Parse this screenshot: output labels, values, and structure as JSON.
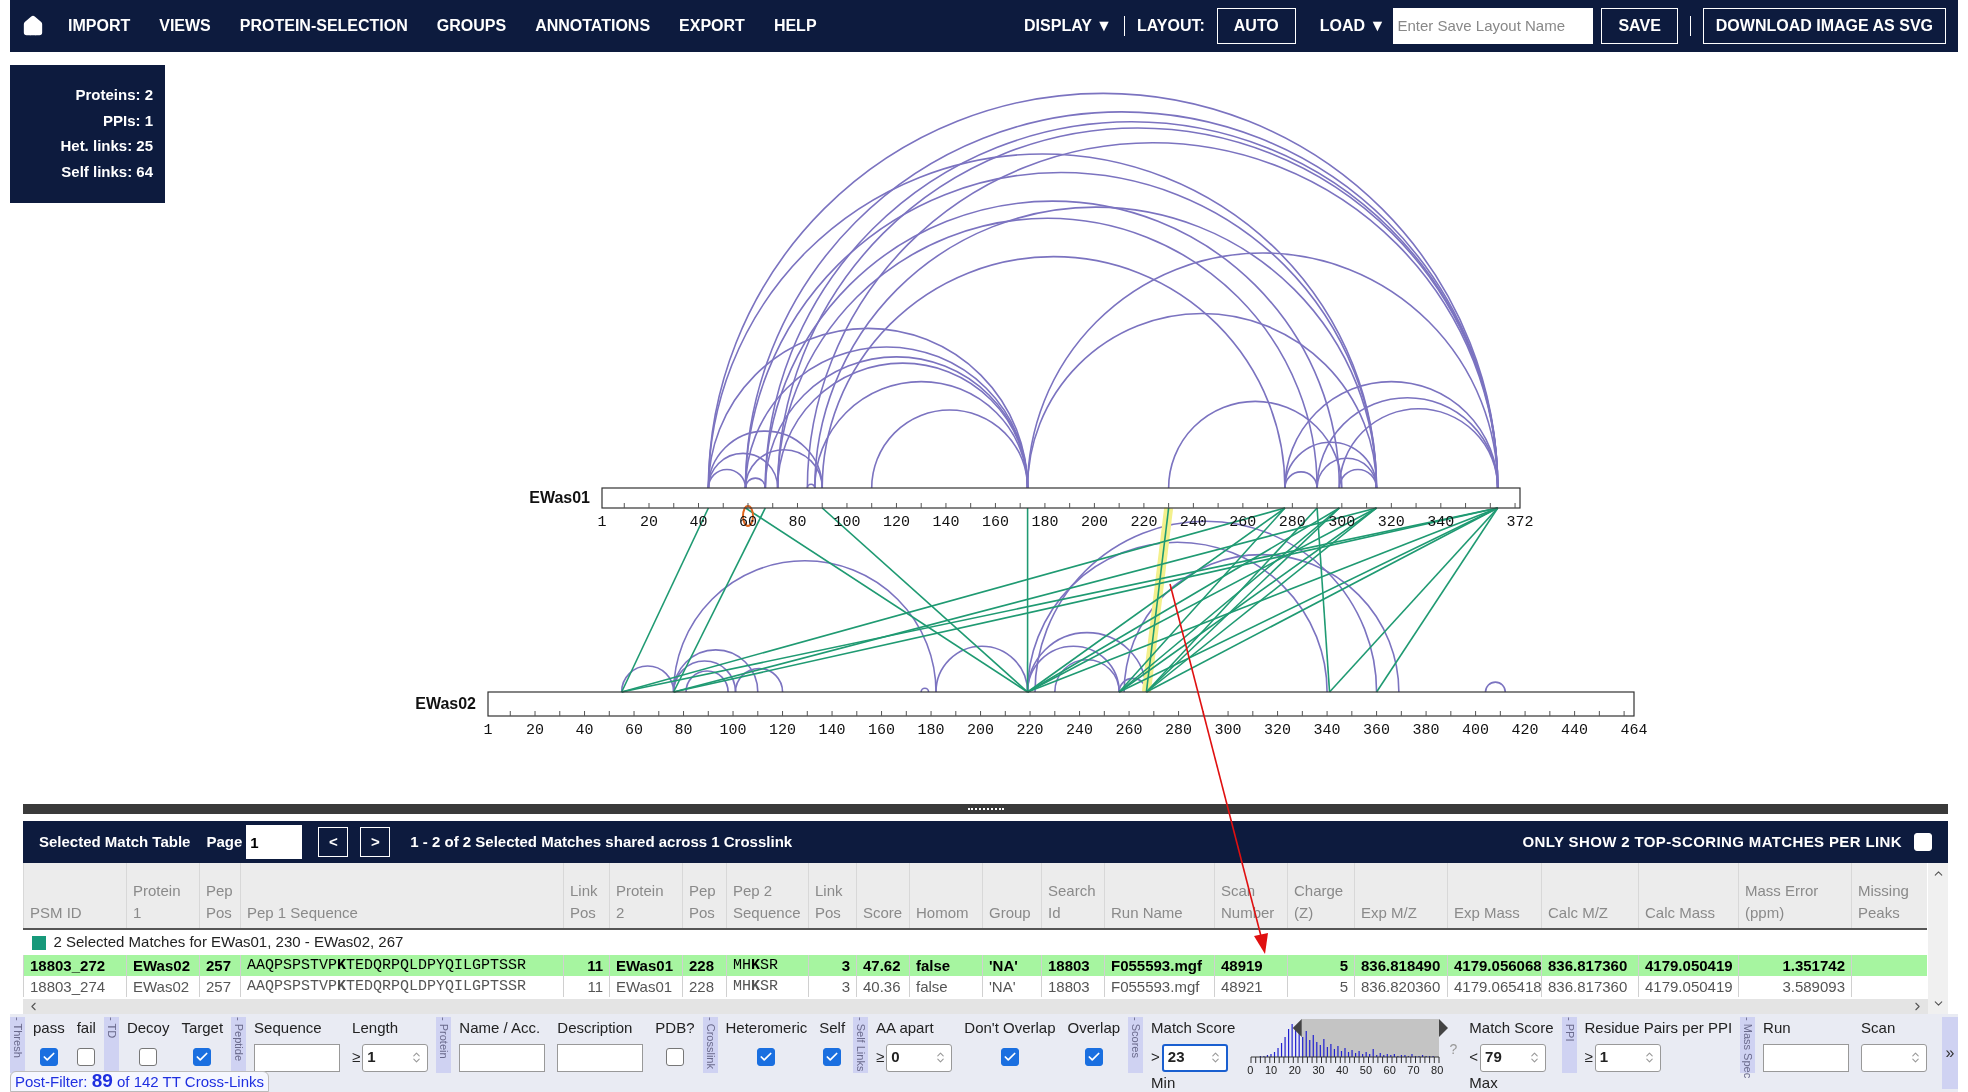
{
  "nav": {
    "items": [
      "IMPORT",
      "VIEWS",
      "PROTEIN-SELECTION",
      "GROUPS",
      "ANNOTATIONS",
      "EXPORT",
      "HELP"
    ],
    "display": "DISPLAY ▼",
    "layout_label": "LAYOUT:",
    "auto": "AUTO",
    "load": "LOAD ▼",
    "layout_name": {
      "placeholder": "Enter Save Layout Name"
    },
    "save": "SAVE",
    "download": "DOWNLOAD IMAGE AS SVG"
  },
  "stats": [
    "Proteins: 2",
    "PPIs: 1",
    "Het. links: 25",
    "Self links: 64"
  ],
  "proteins": [
    {
      "name": "EWas01",
      "ticks": [
        "1",
        "20",
        "40",
        "60",
        "80",
        "100",
        "120",
        "140",
        "160",
        "180",
        "200",
        "220",
        "240",
        "260",
        "280",
        "300",
        "320",
        "340",
        "372"
      ]
    },
    {
      "name": "EWas02",
      "ticks": [
        "1",
        "20",
        "40",
        "60",
        "80",
        "100",
        "120",
        "140",
        "160",
        "180",
        "200",
        "220",
        "240",
        "260",
        "280",
        "300",
        "320",
        "340",
        "360",
        "380",
        "400",
        "420",
        "440",
        "464"
      ]
    }
  ],
  "match_table": {
    "title": "Selected Match Table",
    "page_label": "Page",
    "page": "1",
    "prev": "<",
    "next": ">",
    "summary": "1 - 2 of 2 Selected Matches shared across 1 Crosslink",
    "top_scoring": {
      "label": "ONLY SHOW 2 TOP-SCORING MATCHES PER LINK",
      "checked": false
    },
    "columns": [
      {
        "label": "PSM ID",
        "kind": "text"
      },
      {
        "label": "Protein 1",
        "kind": "text"
      },
      {
        "label": "Pep Pos",
        "kind": "text"
      },
      {
        "label": "Pep 1 Sequence",
        "kind": "sequence"
      },
      {
        "label": "Link Pos",
        "kind": "numeric"
      },
      {
        "label": "Protein 2",
        "kind": "text"
      },
      {
        "label": "Pep Pos",
        "kind": "text"
      },
      {
        "label": "Pep 2 Sequence",
        "kind": "sequence"
      },
      {
        "label": "Link Pos",
        "kind": "numeric"
      },
      {
        "label": "Score",
        "kind": "text"
      },
      {
        "label": "Homom",
        "kind": "text"
      },
      {
        "label": "Group",
        "kind": "text"
      },
      {
        "label": "Search Id",
        "kind": "text"
      },
      {
        "label": "Run Name",
        "kind": "text"
      },
      {
        "label": "Scan Number",
        "kind": "text"
      },
      {
        "label": "Charge (Z)",
        "kind": "numeric"
      },
      {
        "label": "Exp M/Z",
        "kind": "text"
      },
      {
        "label": "Exp Mass",
        "kind": "text"
      },
      {
        "label": "Calc M/Z",
        "kind": "text"
      },
      {
        "label": "Calc Mass",
        "kind": "text"
      },
      {
        "label": "Mass Error (ppm)",
        "kind": "numeric"
      },
      {
        "label": "Missing Peaks",
        "kind": "text"
      }
    ],
    "group": "2 Selected Matches for EWas01, 230 - EWas02, 267",
    "rows": [
      {
        "selected": true,
        "cells": [
          "18803_272",
          "EWas02",
          "257",
          "AAQPSPSTVP**K**TEDQRPQLDPYQILGPTSSR",
          "11",
          "EWas01",
          "228",
          "MH**K**SR",
          "3",
          "47.62",
          "false",
          "'NA'",
          "18803",
          "F055593.mgf",
          "48919",
          "5",
          "836.818490",
          "4179.056068",
          "836.817360",
          "4179.050419",
          "1.351742"
        ]
      },
      {
        "selected": false,
        "cells": [
          "18803_274",
          "EWas02",
          "257",
          "AAQPSPSTVP**K**TEDQRPQLDPYQILGPTSSR",
          "11",
          "EWas01",
          "228",
          "MH**K**SR",
          "3",
          "40.36",
          "false",
          "'NA'",
          "18803",
          "F055593.mgf",
          "48921",
          "5",
          "836.820360",
          "4179.065418",
          "836.817360",
          "4179.050419",
          "3.589093"
        ]
      }
    ]
  },
  "filter_groups": [
    {
      "label": "- Thresh",
      "controls": [
        {
          "kind": "checkbox",
          "label": "pass",
          "checked": true
        },
        {
          "kind": "checkbox",
          "label": "fail",
          "checked": false
        }
      ]
    },
    {
      "label": "- TD",
      "controls": [
        {
          "kind": "checkbox",
          "label": "Decoy",
          "checked": false
        },
        {
          "kind": "checkbox",
          "label": "Target",
          "checked": true
        }
      ]
    },
    {
      "label": "- Peptide",
      "controls": [
        {
          "kind": "text",
          "label": "Sequence"
        },
        {
          "kind": "number",
          "label": "Length",
          "prefix": "≥",
          "value": "1",
          "focused": false
        }
      ]
    },
    {
      "label": "- Protein",
      "controls": [
        {
          "kind": "text",
          "label": "Name / Acc."
        },
        {
          "kind": "text",
          "label": "Description"
        },
        {
          "kind": "checkbox",
          "label": "PDB?",
          "checked": false
        }
      ]
    },
    {
      "label": "- Crosslink",
      "controls": [
        {
          "kind": "checkbox",
          "label": "Heteromeric",
          "checked": true
        },
        {
          "kind": "checkbox",
          "label": "Self",
          "checked": true
        }
      ]
    },
    {
      "label": "- Self Links",
      "controls": [
        {
          "kind": "number",
          "label": "AA apart",
          "prefix": "≥",
          "value": "0",
          "focused": false
        },
        {
          "kind": "checkbox",
          "label": "Don't Overlap",
          "checked": true
        },
        {
          "kind": "checkbox",
          "label": "Overlap",
          "checked": true
        }
      ]
    },
    {
      "label": "- Scores",
      "controls": [
        {
          "kind": "number",
          "label": "Match Score",
          "prefix": ">",
          "value": "23",
          "focused": true,
          "caption": "Min"
        },
        {
          "kind": "histogram",
          "help": "?",
          "ticks": [
            "0",
            "10",
            "20",
            "30",
            "40",
            "50",
            "60",
            "70",
            "80"
          ],
          "thumbs": [
            {
              "level": 0.27
            },
            {
              "level": 1
            }
          ]
        },
        {
          "kind": "number",
          "label": "Match Score",
          "prefix": "<",
          "value": "79",
          "focused": false,
          "caption": "Max"
        }
      ]
    },
    {
      "label": "- PPI",
      "controls": [
        {
          "kind": "number",
          "label": "Residue Pairs per PPI",
          "prefix": "≥",
          "value": "1",
          "focused": false
        }
      ]
    },
    {
      "label": "- Mass Spec",
      "controls": [
        {
          "kind": "text",
          "label": "Run"
        },
        {
          "kind": "number",
          "label": "Scan",
          "focused": false
        }
      ]
    }
  ],
  "expand": "»",
  "post_filter": "Post-Filter: **89** of 142 TT Cross-Links"
}
